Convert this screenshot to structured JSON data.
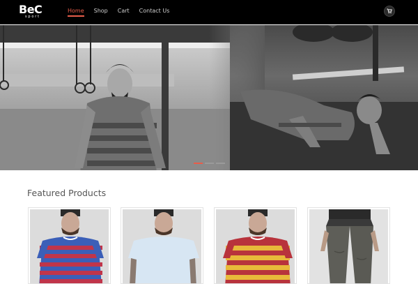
{
  "brand": {
    "name": "BeC",
    "tagline": "sport"
  },
  "nav": {
    "items": [
      "Home",
      "Shop",
      "Cart",
      "Contact Us"
    ],
    "active_index": 0
  },
  "colors": {
    "accent": "#e85d4a",
    "navbar": "#000000",
    "text": "#555555"
  },
  "icons": {
    "cart": "shopping-cart-icon"
  },
  "hero": {
    "slide_count": 3,
    "active_slide": 1
  },
  "featured": {
    "title": "Featured Products",
    "products": [
      {
        "image": "Striped blue and red tee"
      },
      {
        "image": "Light blue tee"
      },
      {
        "image": "Striped yellow and red tee"
      },
      {
        "image": "Grey jogger pants"
      }
    ]
  }
}
